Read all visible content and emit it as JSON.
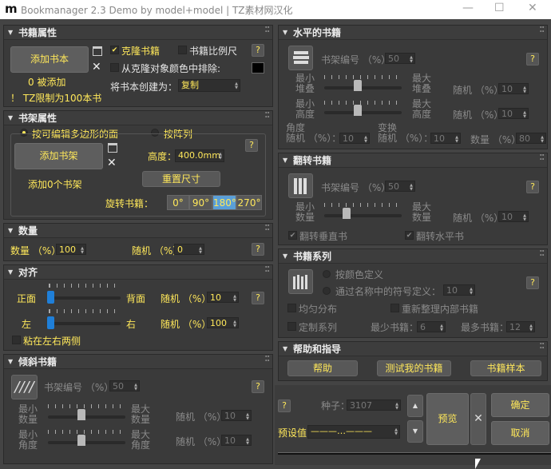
{
  "window": {
    "title": "Bookmanager 2.3 Demo by model+model | TZ素材网汉化",
    "logo": "m",
    "min": "—",
    "max": "☐",
    "close": "✕"
  },
  "book_props": {
    "header": "书籍属性",
    "add_btn": "添加书本",
    "added": "0 被添加",
    "limit": "！ TZ限制为100本书",
    "clone": "克隆书籍",
    "scale": "书籍比例尺",
    "exclude": "从克隆对象颜色中排除:",
    "create_as": "将书本创建为：",
    "create_value": "复制",
    "help": "?"
  },
  "shelf_props": {
    "header": "书架属性",
    "opt1": "按可编辑多边形的面",
    "opt2": "按阵列",
    "add_btn": "添加书架",
    "added": "添加0个书架",
    "height_label": "高度：",
    "height_value": "400.0mm",
    "reset": "重置尺寸",
    "rotate_label": "旋转书籍：",
    "angles": [
      "0°",
      "90°",
      "180°",
      "270°"
    ],
    "help": "?"
  },
  "quantity": {
    "header": "数量",
    "qty_label": "数量 （%）：",
    "qty_value": "100",
    "rand_label": "随机 （%）",
    "rand_value": "0",
    "help": "?"
  },
  "align": {
    "header": "对齐",
    "front": "正面",
    "back": "背面",
    "left": "左",
    "right": "右",
    "rand1_label": "随机 （%）：",
    "rand1_value": "10",
    "rand2_label": "随机 （%）：",
    "rand2_value": "100",
    "stick": "粘在左右两侧",
    "help": "?"
  },
  "tilt": {
    "header": "倾斜书籍",
    "num_label": "书架编号 （%）：",
    "num_value": "50",
    "min_qty": "最小\n数量",
    "max_qty": "最大\n数量",
    "min_angle": "最小\n角度",
    "max_angle": "最大\n角度",
    "rand1": "随机 （%）：",
    "rand1_value": "10",
    "rand2": "随机 （%）：",
    "rand2_value": "10",
    "help": "?"
  },
  "horizontal": {
    "header": "水平的书籍",
    "num_label": "书架编号 （%）：",
    "num_value": "50",
    "min_stack": "最小\n堆叠",
    "max_stack": "最大\n堆叠",
    "min_h": "最小\n高度",
    "max_h": "最大\n高度",
    "rand1": "随机 （%）：",
    "rand1_value": "10",
    "rand2": "随机 （%）：",
    "rand2_value": "10",
    "angle_rand": "角度\n随机 （%）：",
    "angle_value": "10",
    "swap_rand": "变换\n随机 （%）：",
    "swap_value": "10",
    "qty_label": "数量 （%）：",
    "qty_value": "80",
    "help": "?"
  },
  "flip": {
    "header": "翻转书籍",
    "num_label": "书架编号 （%）：",
    "num_value": "50",
    "min_qty": "最小\n数量",
    "max_qty": "最大\n数量",
    "rand": "随机 （%）：",
    "rand_value": "10",
    "flip_v": "翻转垂直书",
    "flip_h": "翻转水平书",
    "help": "?"
  },
  "series": {
    "header": "书籍系列",
    "opt1": "按颜色定义",
    "opt2": "通过名称中的符号定义：",
    "sym_value": "10",
    "even": "均匀分布",
    "reorg": "重新整理内部书籍",
    "custom": "定制系列",
    "min_label": "最少书籍：",
    "min_value": "6",
    "max_label": "最多书籍：",
    "max_value": "12",
    "help": "?"
  },
  "help_guide": {
    "header": "帮助和指导",
    "help": "帮助",
    "test": "测试我的书籍",
    "samples": "书籍样本"
  },
  "bottom": {
    "help": "?",
    "seed_label": "种子：",
    "seed_value": "3107",
    "preset_label": "预设值",
    "preset_value": "———…———",
    "preview": "预览",
    "close": "✕",
    "ok": "确定",
    "cancel": "取消"
  },
  "colors": {
    "accent": "#ffe85a",
    "highlight": "#5a9fd8"
  }
}
